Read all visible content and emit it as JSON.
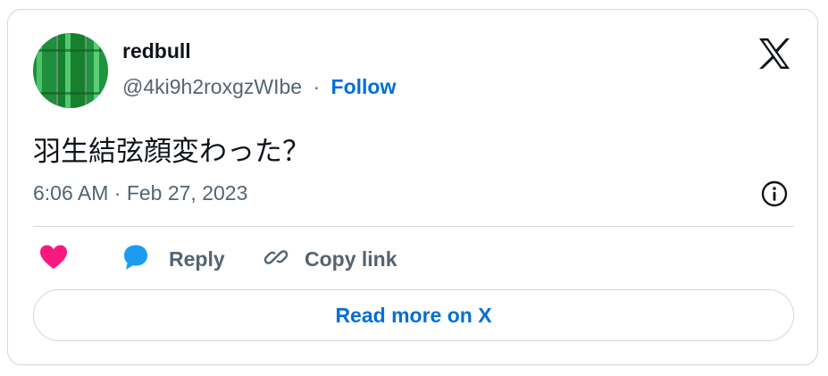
{
  "author": {
    "name": "redbull",
    "handle": "@4ki9h2roxgzWIbe",
    "separator": "·",
    "follow_label": "Follow"
  },
  "tweet": {
    "text": "羽生結弦顔変わった？",
    "timestamp": "6:06 AM · Feb 27, 2023"
  },
  "actions": {
    "reply_label": "Reply",
    "copy_link_label": "Copy link"
  },
  "read_more_label": "Read more on X",
  "icons": {
    "platform_logo": "x-logo-icon",
    "info": "info-icon",
    "like": "heart-icon",
    "reply": "speech-bubble-icon",
    "copy": "link-icon"
  },
  "colors": {
    "link_blue": "#006fd6",
    "heart_pink": "#f91880",
    "reply_blue": "#1d9bf0",
    "muted_text": "#536471",
    "border": "#cfd9de"
  }
}
